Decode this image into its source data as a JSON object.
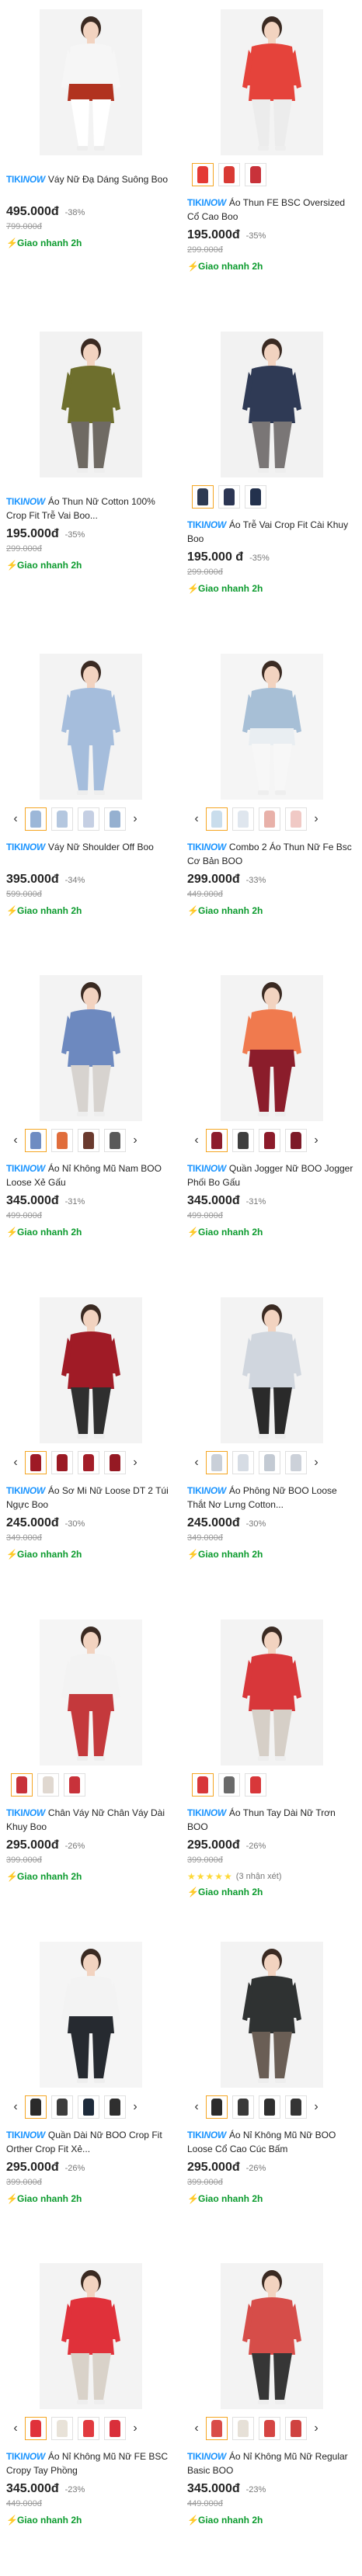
{
  "brand": {
    "tiki": "TIKI",
    "now": "NOW"
  },
  "products": [
    {
      "name": "Váy Nữ Đạ Dáng Suông Boo",
      "price": "495.000đ",
      "discount": "-38%",
      "old_price": "799.000đ",
      "shipping": "Giao nhanh 2h",
      "thumbs": [],
      "colors": {
        "top": "#f6f6f6",
        "main": "#b1321f",
        "under": "#ffffff",
        "bg": "#f3f3f3"
      }
    },
    {
      "name": "Áo Thun FE BSC Oversized Cổ Cao Boo",
      "price": "195.000đ",
      "discount": "-35%",
      "old_price": "299.000đ",
      "shipping": "Giao nhanh 2h",
      "thumbs": [
        "#e43a35",
        "#d93a34",
        "#c8323a"
      ],
      "colors": {
        "top": "#e5433b",
        "main": "#e5433b",
        "under": "#ececec",
        "bg": "#f3f3f3"
      }
    },
    {
      "name": "Áo Thun Nữ Cotton 100% Crop Fit Trễ Vai Boo...",
      "price": "195.000đ",
      "discount": "-35%",
      "old_price": "299.000đ",
      "shipping": "Giao nhanh 2h",
      "thumbs": [],
      "colors": {
        "top": "#6e6f2d",
        "main": "#6e6f2d",
        "under": "#6f6a63",
        "bg": "#f2f2f2"
      }
    },
    {
      "name": "Áo Trễ Vai Crop Fit Cài Khuy Boo",
      "price": "195.000 đ",
      "discount": "-35%",
      "old_price": "299.000đ",
      "shipping": "Giao nhanh 2h",
      "thumbs": [
        "#2d3a52",
        "#2c3654",
        "#23314d"
      ],
      "colors": {
        "top": "#2f3a55",
        "main": "#2f3a55",
        "under": "#7a7676",
        "bg": "#f2f2f2"
      }
    },
    {
      "name": "Váy Nữ Shoulder Off Boo",
      "price": "395.000đ",
      "discount": "-34%",
      "old_price": "599.000đ",
      "shipping": "Giao nhanh 2h",
      "thumbs": [
        "#9cb7d8",
        "#b4c7df",
        "#c5cfe3",
        "#95b0d0"
      ],
      "colors": {
        "top": "#a5bddc",
        "main": "#a5bddc",
        "under": "#a5bddc",
        "bg": "#f3f3f3"
      }
    },
    {
      "name": "Combo 2 Áo Thun Nữ Fe Bsc Cơ Bản BOO",
      "price": "299.000đ",
      "discount": "-33%",
      "old_price": "449.000đ",
      "shipping": "Giao nhanh 2h",
      "thumbs": [
        "#c9ddec",
        "#dfe6ee",
        "#e8b1a9",
        "#f0c9c5"
      ],
      "colors": {
        "top": "#a7bfd6",
        "main": "#e9eef2",
        "under": "#f7f7f7",
        "bg": "#f5f5f5"
      }
    },
    {
      "name": "Áo Nỉ Không Mũ Nam BOO Loose Xẻ Gấu",
      "price": "345.000đ",
      "discount": "-31%",
      "old_price": "499.000đ",
      "shipping": "Giao nhanh 2h",
      "thumbs": [
        "#6e8cc2",
        "#e06d3b",
        "#6a3a2e",
        "#5a5a5a"
      ],
      "colors": {
        "top": "#6d89bf",
        "main": "#6d89bf",
        "under": "#d7d3cf",
        "bg": "#f3f3f3"
      }
    },
    {
      "name": "Quần Jogger Nữ BOO Jogger Phối Bo Gấu",
      "price": "345.000đ",
      "discount": "-31%",
      "old_price": "499.000đ",
      "shipping": "Giao nhanh 2h",
      "thumbs": [
        "#8d1d2c",
        "#3e3e3e",
        "#8c1b2a",
        "#7d1a28"
      ],
      "colors": {
        "top": "#f07a4e",
        "main": "#8b1d2b",
        "under": "#8b1d2b",
        "bg": "#f3f3f3"
      }
    },
    {
      "name": "Áo Sơ Mi Nữ Loose DT 2 Túi Ngực Boo",
      "price": "245.000đ",
      "discount": "-30%",
      "old_price": "349.000đ",
      "shipping": "Giao nhanh 2h",
      "thumbs": [
        "#9e1a25",
        "#9b1a24",
        "#a31d28",
        "#951923"
      ],
      "colors": {
        "top": "#a01b26",
        "main": "#a01b26",
        "under": "#2f2f2f",
        "bg": "#f3f3f3"
      }
    },
    {
      "name": "Áo Phông Nữ BOO Loose Thắt Nơ Lưng Cotton...",
      "price": "245.000đ",
      "discount": "-30%",
      "old_price": "349.000đ",
      "shipping": "Giao nhanh 2h",
      "thumbs": [
        "#c9cfd8",
        "#d6dce4",
        "#c3cad3",
        "#ccd1d9"
      ],
      "colors": {
        "top": "#d0d6de",
        "main": "#d0d6de",
        "under": "#2a2a2a",
        "bg": "#f3f3f3"
      }
    },
    {
      "name": "Chân Váy Nữ Chân Váy Dài Khuy Boo",
      "price": "295.000đ",
      "discount": "-26%",
      "old_price": "399.000đ",
      "shipping": "Giao nhanh 2h",
      "thumbs": [
        "#c8323a",
        "#e0d8d0",
        "#c8323a"
      ],
      "colors": {
        "top": "#f3f3f3",
        "main": "#c4393c",
        "under": "#c4393c",
        "bg": "#f5f5f5"
      }
    },
    {
      "name": "Áo Thun Tay Dài Nữ Trơn BOO",
      "price": "295.000đ",
      "discount": "-26%",
      "old_price": "399.000đ",
      "shipping": "Giao nhanh 2h",
      "rating": "(3 nhận xét)",
      "thumbs": [
        "#d8373a",
        "#6a6a6a",
        "#d8373a"
      ],
      "colors": {
        "top": "#d8373a",
        "main": "#d8373a",
        "under": "#d6cfc7",
        "bg": "#f3f3f3"
      }
    },
    {
      "name": "Quần Dài Nữ BOO Crop Fit Orther Crop Fit Xẻ...",
      "price": "295.000đ",
      "discount": "-26%",
      "old_price": "399.000đ",
      "shipping": "Giao nhanh 2h",
      "thumbs": [
        "#2a2a2a",
        "#3d3d3d",
        "#1e2b3b",
        "#2f2f2f"
      ],
      "colors": {
        "top": "#f3f3f3",
        "main": "#262a30",
        "under": "#262a30",
        "bg": "#f5f5f5"
      }
    },
    {
      "name": "Áo Nỉ Không Mũ Nữ BOO Loose Cổ Cao Cúc Bấm",
      "price": "295.000đ",
      "discount": "-26%",
      "old_price": "399.000đ",
      "shipping": "Giao nhanh 2h",
      "thumbs": [
        "#2b2b2b",
        "#3a3a3a",
        "#2f2f2f",
        "#353535"
      ],
      "colors": {
        "top": "#2f3232",
        "main": "#2f3232",
        "under": "#6a5e55",
        "bg": "#f3f3f3"
      }
    },
    {
      "name": "Áo Nỉ Không Mũ Nữ FE BSC Cropy Tay Phồng",
      "price": "345.000đ",
      "discount": "-23%",
      "old_price": "449.000đ",
      "shipping": "Giao nhanh 2h",
      "thumbs": [
        "#e0313a",
        "#e8e2d8",
        "#e13a3f",
        "#d92f3a"
      ],
      "colors": {
        "top": "#e0313a",
        "main": "#e0313a",
        "under": "#d9d2c9",
        "bg": "#f3f3f3"
      }
    },
    {
      "name": "Áo Nỉ Không Mũ Nữ Regular Basic BOO",
      "price": "345.000đ",
      "discount": "-23%",
      "old_price": "449.000đ",
      "shipping": "Giao nhanh 2h",
      "thumbs": [
        "#d94c48",
        "#e6e0d7",
        "#d54543",
        "#cf4240"
      ],
      "colors": {
        "top": "#d64d49",
        "main": "#d64d49",
        "under": "#363636",
        "bg": "#f3f3f3"
      }
    }
  ]
}
